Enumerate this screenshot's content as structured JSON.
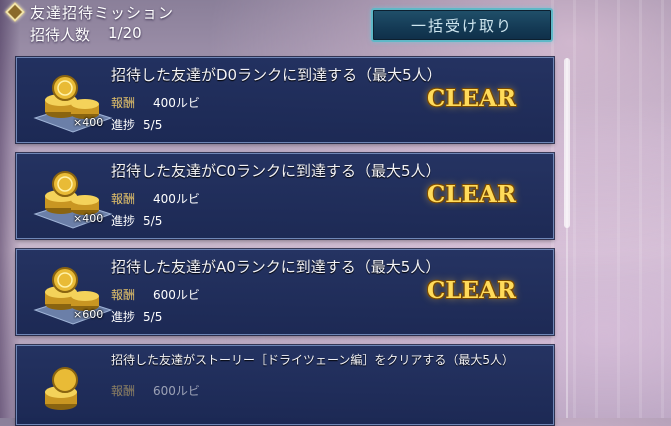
{
  "header": {
    "title": "友達招待ミッション",
    "invite_label": "招待人数",
    "invite_count": "1/20"
  },
  "collect_all_label": "一括受け取り",
  "labels": {
    "reward": "報酬",
    "progress": "進捗"
  },
  "missions": [
    {
      "title": "招待した友達がD0ランクに到達する（最大5人）",
      "qty": "×400",
      "reward": "400ルビ",
      "progress": "5/5",
      "status": "CLEAR"
    },
    {
      "title": "招待した友達がC0ランクに到達する（最大5人）",
      "qty": "×400",
      "reward": "400ルビ",
      "progress": "5/5",
      "status": "CLEAR"
    },
    {
      "title": "招待した友達がA0ランクに到達する（最大5人）",
      "qty": "×600",
      "reward": "600ルビ",
      "progress": "5/5",
      "status": "CLEAR"
    },
    {
      "title": "招待した友達がストーリー［ドライツェーン編］をクリアする（最大5人）",
      "reward": "600ルビ"
    }
  ],
  "colors": {
    "clear_gold": "#ffdb5a",
    "label_gold": "#e4c26a",
    "panel_navy": "#1c2c5c",
    "button_teal": "#5fb8c7"
  }
}
